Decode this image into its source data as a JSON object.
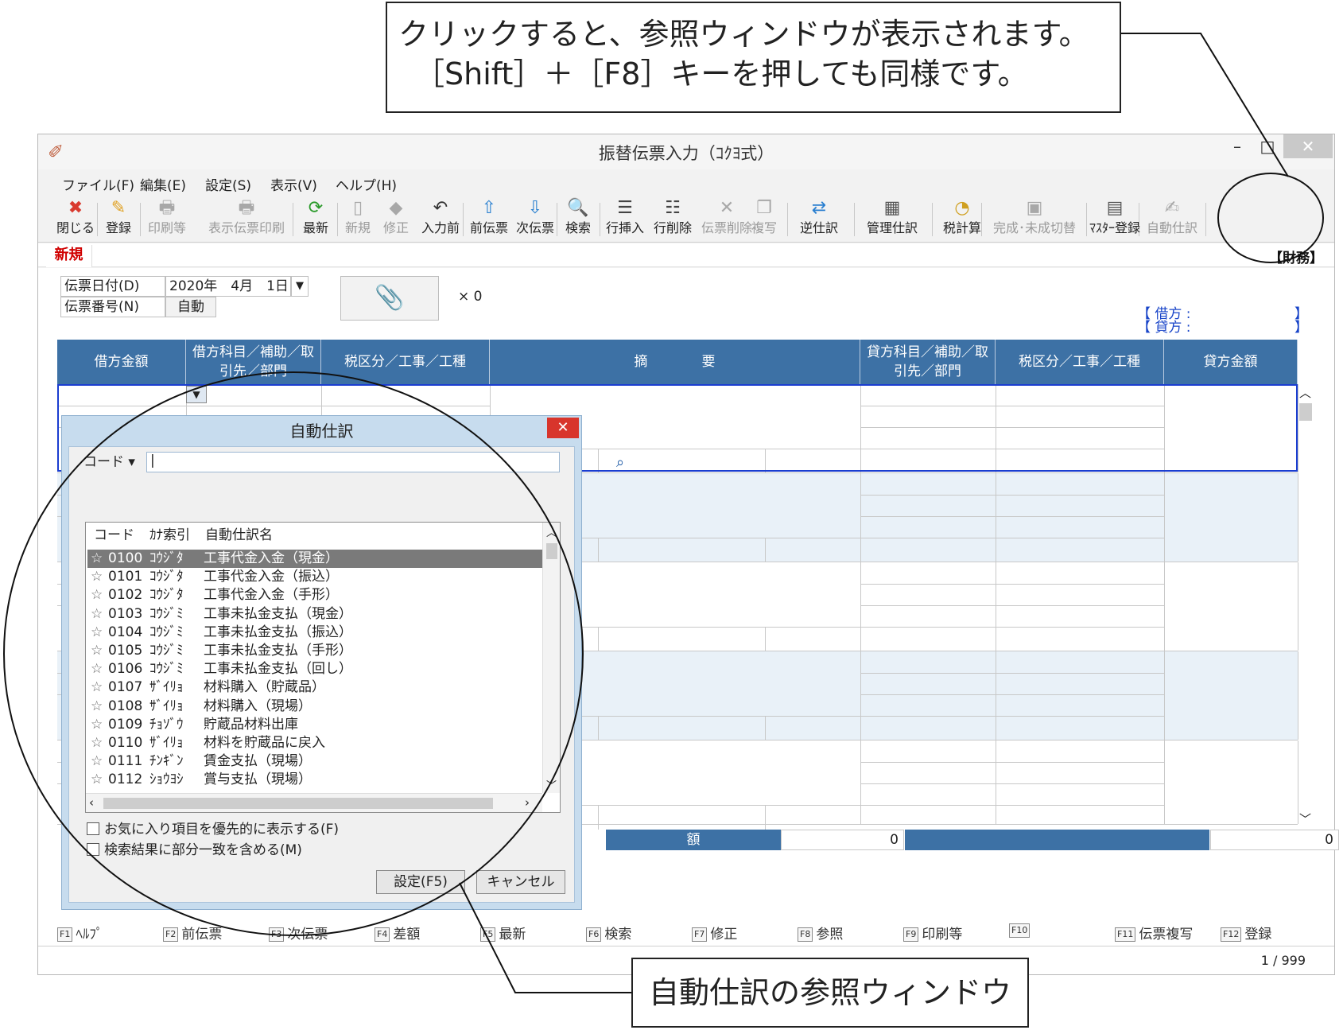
{
  "callouts": {
    "top_line1": "クリックすると、参照ウィンドウが表示されます。",
    "top_line2": "［Shift］＋［F8］キーを押しても同様です。",
    "bottom": "自動仕訳の参照ウィンドウ"
  },
  "window": {
    "title": "振替伝票入力（ｺｸﾖ式）",
    "min": "–",
    "max": "□",
    "close": "✕"
  },
  "menu": [
    "ファイル(F)",
    "編集(E)",
    "設定(S)",
    "表示(V)",
    "ヘルプ(H)"
  ],
  "toolbar": [
    {
      "label": "閉じる",
      "icon": "close-x-icon",
      "glyph": "✖",
      "color": "#d93a2f",
      "enabled": true
    },
    {
      "label": "登録",
      "icon": "register-icon",
      "glyph": "✎",
      "color": "#e0a020",
      "enabled": true
    },
    {
      "label": "印刷等",
      "icon": "printer-icon",
      "glyph": "🖶",
      "color": "#888",
      "enabled": false
    },
    {
      "label": "表示伝票印刷",
      "icon": "printer-icon",
      "glyph": "🖶",
      "color": "#888",
      "enabled": false
    },
    {
      "label": "最新",
      "icon": "refresh-icon",
      "glyph": "⟳",
      "color": "#2a9a2a",
      "enabled": true
    },
    {
      "label": "新規",
      "icon": "new-doc-icon",
      "glyph": "▯",
      "color": "#999",
      "enabled": false
    },
    {
      "label": "修正",
      "icon": "eraser-icon",
      "glyph": "◆",
      "color": "#999",
      "enabled": false
    },
    {
      "label": "入力前",
      "icon": "undo-doc-icon",
      "glyph": "↶",
      "color": "#333",
      "enabled": true
    },
    {
      "label": "前伝票",
      "icon": "prev-slip-icon",
      "glyph": "⇧",
      "color": "#2a80d0",
      "enabled": true
    },
    {
      "label": "次伝票",
      "icon": "next-slip-icon",
      "glyph": "⇩",
      "color": "#2a80d0",
      "enabled": true
    },
    {
      "label": "検索",
      "icon": "magnifier-icon",
      "glyph": "🔍",
      "color": "#333",
      "enabled": true
    },
    {
      "label": "行挿入",
      "icon": "insert-row-icon",
      "glyph": "☰",
      "color": "#444",
      "enabled": true
    },
    {
      "label": "行削除",
      "icon": "delete-row-icon",
      "glyph": "☷",
      "color": "#444",
      "enabled": true
    },
    {
      "label": "伝票削除",
      "icon": "delete-slip-icon",
      "glyph": "✕",
      "color": "#999",
      "enabled": false
    },
    {
      "label": "複写",
      "icon": "copy-icon",
      "glyph": "❐",
      "color": "#999",
      "enabled": false
    },
    {
      "label": "逆仕訳",
      "icon": "reverse-entry-icon",
      "glyph": "⇄",
      "color": "#2a7fd0",
      "enabled": true
    },
    {
      "label": "管理仕訳",
      "icon": "management-entry-icon",
      "glyph": "▦",
      "color": "#555",
      "enabled": true
    },
    {
      "label": "税計算",
      "icon": "tax-calc-icon",
      "glyph": "◔",
      "color": "#d0a020",
      "enabled": true
    },
    {
      "label": "完成･未成切替",
      "icon": "switch-icon",
      "glyph": "▣",
      "color": "#999",
      "enabled": false
    },
    {
      "label": "ﾏｽﾀｰ登録",
      "icon": "master-register-icon",
      "glyph": "▤",
      "color": "#555",
      "enabled": true
    },
    {
      "label": "自動仕訳",
      "icon": "auto-entry-icon",
      "glyph": "✍",
      "color": "#999",
      "enabled": false
    }
  ],
  "mode_tab": "新規",
  "mode_right": "【財務】",
  "form": {
    "date_label": "伝票日付(D)",
    "date_value": "2020年　4月　1日",
    "number_label": "伝票番号(N)",
    "number_value": "自動",
    "attach_count": "× 0",
    "debit_marker": "【 借方 :",
    "credit_marker": "【 貸方 :",
    "bracket_close_1": "】",
    "bracket_close_2": "】"
  },
  "grid": {
    "headers": [
      "借方金額",
      "借方科目／補助／取引先／部門",
      "税区分／工事／工種",
      "摘　　　　要",
      "貸方科目／補助／取引先／部門",
      "税区分／工事／工種",
      "貸方金額"
    ],
    "total_label": "額",
    "total_debit": "0",
    "total_credit": "0"
  },
  "fkeys": [
    {
      "key": "F1",
      "label": "ﾍﾙﾌﾟ"
    },
    {
      "key": "F2",
      "label": "前伝票"
    },
    {
      "key": "F3",
      "label": "次伝票"
    },
    {
      "key": "F4",
      "label": "差額"
    },
    {
      "key": "F5",
      "label": "最新"
    },
    {
      "key": "F6",
      "label": "検索"
    },
    {
      "key": "F7",
      "label": "修正"
    },
    {
      "key": "F8",
      "label": "参照"
    },
    {
      "key": "F9",
      "label": "印刷等"
    },
    {
      "key": "F10",
      "label": ""
    },
    {
      "key": "F11",
      "label": "伝票複写"
    },
    {
      "key": "F12",
      "label": "登録"
    }
  ],
  "page_count": "1 / 999",
  "dialog": {
    "title": "自動仕訳",
    "close": "✕",
    "search_mode": "コード ▾",
    "search_value": "|",
    "columns": [
      "コード",
      "ｶﾅ索引",
      "自動仕訳名"
    ],
    "rows": [
      {
        "code": "0100",
        "kana": "ｺｳｼﾞﾀ",
        "name": "工事代金入金（現金）",
        "selected": true
      },
      {
        "code": "0101",
        "kana": "ｺｳｼﾞﾀ",
        "name": "工事代金入金（振込）",
        "selected": false
      },
      {
        "code": "0102",
        "kana": "ｺｳｼﾞﾀ",
        "name": "工事代金入金（手形）",
        "selected": false
      },
      {
        "code": "0103",
        "kana": "ｺｳｼﾞﾐ",
        "name": "工事未払金支払（現金）",
        "selected": false
      },
      {
        "code": "0104",
        "kana": "ｺｳｼﾞﾐ",
        "name": "工事未払金支払（振込）",
        "selected": false
      },
      {
        "code": "0105",
        "kana": "ｺｳｼﾞﾐ",
        "name": "工事未払金支払（手形）",
        "selected": false
      },
      {
        "code": "0106",
        "kana": "ｺｳｼﾞﾐ",
        "name": "工事未払金支払（回し）",
        "selected": false
      },
      {
        "code": "0107",
        "kana": "ｻﾞｲﾘｮ",
        "name": "材料購入（貯蔵品）",
        "selected": false
      },
      {
        "code": "0108",
        "kana": "ｻﾞｲﾘｮ",
        "name": "材料購入（現場）",
        "selected": false
      },
      {
        "code": "0109",
        "kana": "ﾁｮｿﾞｳ",
        "name": "貯蔵品材料出庫",
        "selected": false
      },
      {
        "code": "0110",
        "kana": "ｻﾞｲﾘｮ",
        "name": "材料を貯蔵品に戻入",
        "selected": false
      },
      {
        "code": "0111",
        "kana": "ﾁﾝｷﾞﾝ",
        "name": "賃金支払（現場）",
        "selected": false
      },
      {
        "code": "0112",
        "kana": "ｼｮｳﾖｼ",
        "name": "賞与支払（現場）",
        "selected": false
      }
    ],
    "check_favorites": "お気に入り項目を優先的に表示する(F)",
    "check_partial": "検索結果に部分一致を含める(M)",
    "ok_button": "設定(F5)",
    "cancel_button": "キャンセル"
  }
}
